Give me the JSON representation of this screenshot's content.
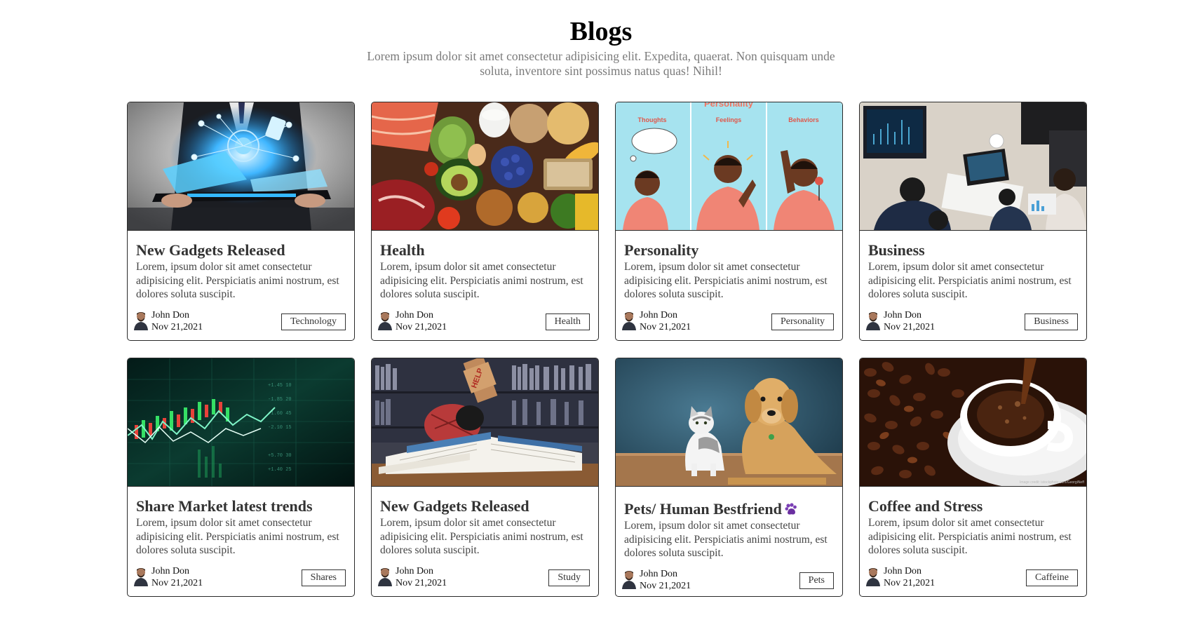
{
  "header": {
    "title": "Blogs",
    "subtitle": "Lorem ipsum dolor sit amet consectetur adipisicing elit. Expedita, quaerat. Non quisquam unde soluta, inventore sint possimus natus quas! Nihil!"
  },
  "cards": [
    {
      "title": "New Gadgets Released",
      "description": "Lorem, ipsum dolor sit amet consectetur adipisicing elit. Perspiciatis animi nostrum, est dolores soluta suscipit.",
      "author": "John Don",
      "date": "Nov 21,2021",
      "tag": "Technology",
      "image": "businessman-holding-tablet-with-hologram"
    },
    {
      "title": "Health",
      "description": "Lorem, ipsum dolor sit amet consectetur adipisicing elit. Perspiciatis animi nostrum, est dolores soluta suscipit.",
      "author": "John Don",
      "date": "Nov 21,2021",
      "tag": "Health",
      "image": "healthy-food-assortment"
    },
    {
      "title": "Personality",
      "description": "Lorem, ipsum dolor sit amet consectetur adipisicing elit. Perspiciatis animi nostrum, est dolores soluta suscipit.",
      "author": "John Don",
      "date": "Nov 21,2021",
      "tag": "Personality",
      "image": "personality-illustration",
      "image_labels": {
        "heading": "Personality",
        "panel1": "Thoughts",
        "panel2": "Feelings",
        "panel3": "Behaviors"
      }
    },
    {
      "title": "Business",
      "description": "Lorem, ipsum dolor sit amet consectetur adipisicing elit. Perspiciatis animi nostrum, est dolores soluta suscipit.",
      "author": "John Don",
      "date": "Nov 21,2021",
      "tag": "Business",
      "image": "business-meeting-overhead"
    },
    {
      "title": "Share Market latest trends",
      "description": "Lorem, ipsum dolor sit amet consectetur adipisicing elit. Perspiciatis animi nostrum, est dolores soluta suscipit.",
      "author": "John Don",
      "date": "Nov 21,2021",
      "tag": "Shares",
      "image": "stock-candlestick-chart"
    },
    {
      "title": "New Gadgets Released",
      "description": "Lorem, ipsum dolor sit amet consectetur adipisicing elit. Perspiciatis animi nostrum, est dolores soluta suscipit.",
      "author": "John Don",
      "date": "Nov 21,2021",
      "tag": "Study",
      "image": "student-buried-in-books",
      "image_labels": {
        "sign": "HELP"
      }
    },
    {
      "title": "Pets/ Human Bestfriend",
      "title_emoji": "purple-paw-icon",
      "description": "Lorem, ipsum dolor sit amet consectetur adipisicing elit. Perspiciatis animi nostrum, est dolores soluta suscipit.",
      "author": "John Don",
      "date": "Nov 21,2021",
      "tag": "Pets",
      "image": "cat-and-dog"
    },
    {
      "title": "Coffee and Stress",
      "description": "Lorem, ipsum dolor sit amet consectetur adipisicing elit. Perspiciatis animi nostrum, est dolores soluta suscipit.",
      "author": "John Don",
      "date": "Nov 21,2021",
      "tag": "Caffeine",
      "image": "coffee-cup-with-beans"
    }
  ],
  "colors": {
    "card_border": "#2a2a2a",
    "subtitle_text": "#7a7a7a",
    "paw_purple": "#7b3fb5"
  }
}
